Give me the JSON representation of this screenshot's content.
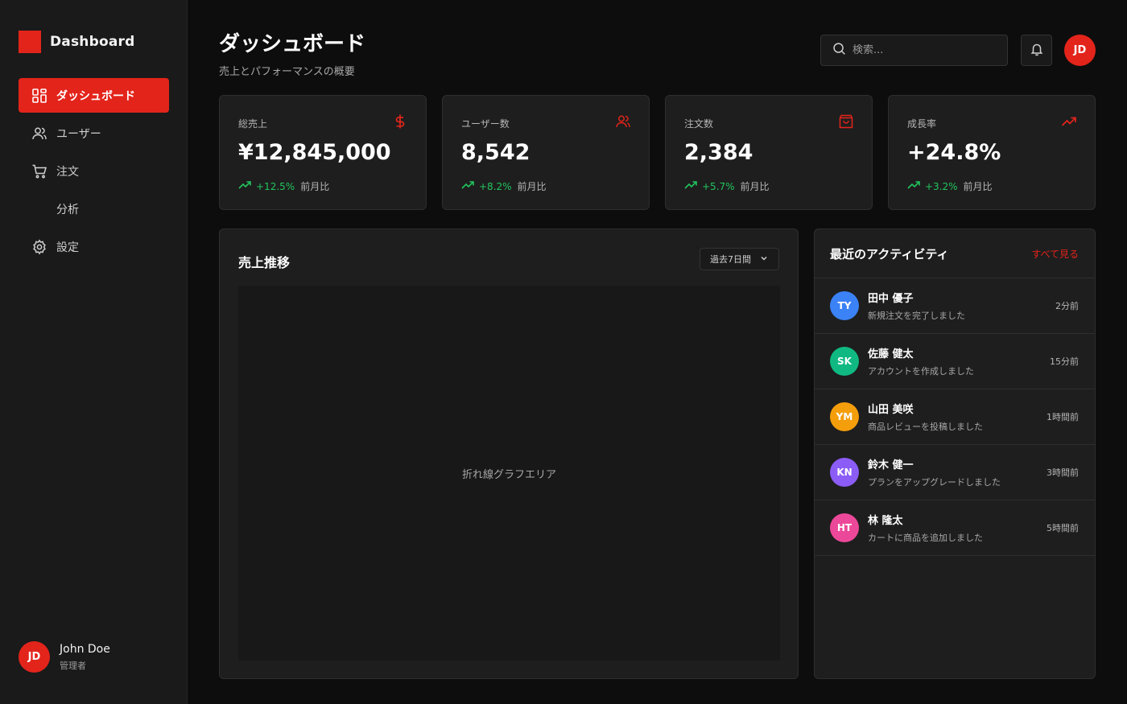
{
  "app": {
    "name": "Dashboard",
    "brand_color": "#e3241b"
  },
  "sidebar": {
    "items": [
      {
        "label": "ダッシュボード",
        "icon": "grid-icon",
        "active": true
      },
      {
        "label": "ユーザー",
        "icon": "users-icon",
        "active": false
      },
      {
        "label": "注文",
        "icon": "cart-icon",
        "active": false
      },
      {
        "label": "分析",
        "icon": "",
        "active": false
      },
      {
        "label": "設定",
        "icon": "gear-icon",
        "active": false
      }
    ],
    "user": {
      "initials": "JD",
      "name": "John Doe",
      "role": "管理者"
    }
  },
  "header": {
    "title": "ダッシュボード",
    "subtitle": "売上とパフォーマンスの概要",
    "search_placeholder": "検索...",
    "user_initials": "JD"
  },
  "stats": [
    {
      "label": "総売上",
      "value": "¥12,845,000",
      "change": "+12.5%",
      "note": "前月比",
      "icon": "dollar-icon"
    },
    {
      "label": "ユーザー数",
      "value": "8,542",
      "change": "+8.2%",
      "note": "前月比",
      "icon": "users-icon"
    },
    {
      "label": "注文数",
      "value": "2,384",
      "change": "+5.7%",
      "note": "前月比",
      "icon": "shopping-bag-icon"
    },
    {
      "label": "成長率",
      "value": "+24.8%",
      "change": "+3.2%",
      "note": "前月比",
      "icon": "trending-up-icon"
    }
  ],
  "sales_chart": {
    "title": "売上推移",
    "range": "過去7日間",
    "placeholder": "折れ線グラフエリア"
  },
  "activity": {
    "title": "最近のアクティビティ",
    "see_all": "すべて見る",
    "items": [
      {
        "initials": "TY",
        "name": "田中 優子",
        "action": "新規注文を完了しました",
        "time": "2分前",
        "color": "#3b82f6"
      },
      {
        "initials": "SK",
        "name": "佐藤 健太",
        "action": "アカウントを作成しました",
        "time": "15分前",
        "color": "#10b981"
      },
      {
        "initials": "YM",
        "name": "山田 美咲",
        "action": "商品レビューを投稿しました",
        "time": "1時間前",
        "color": "#f59e0b"
      },
      {
        "initials": "KN",
        "name": "鈴木 健一",
        "action": "プランをアップグレードしました",
        "time": "3時間前",
        "color": "#8b5cf6"
      },
      {
        "initials": "HT",
        "name": "林 隆太",
        "action": "カートに商品を追加しました",
        "time": "5時間前",
        "color": "#ec4899"
      }
    ]
  },
  "colors": {
    "accent": "#e3241b",
    "positive": "#22c55e",
    "background": "#0d0d0d",
    "panel": "#1e1e1e"
  }
}
